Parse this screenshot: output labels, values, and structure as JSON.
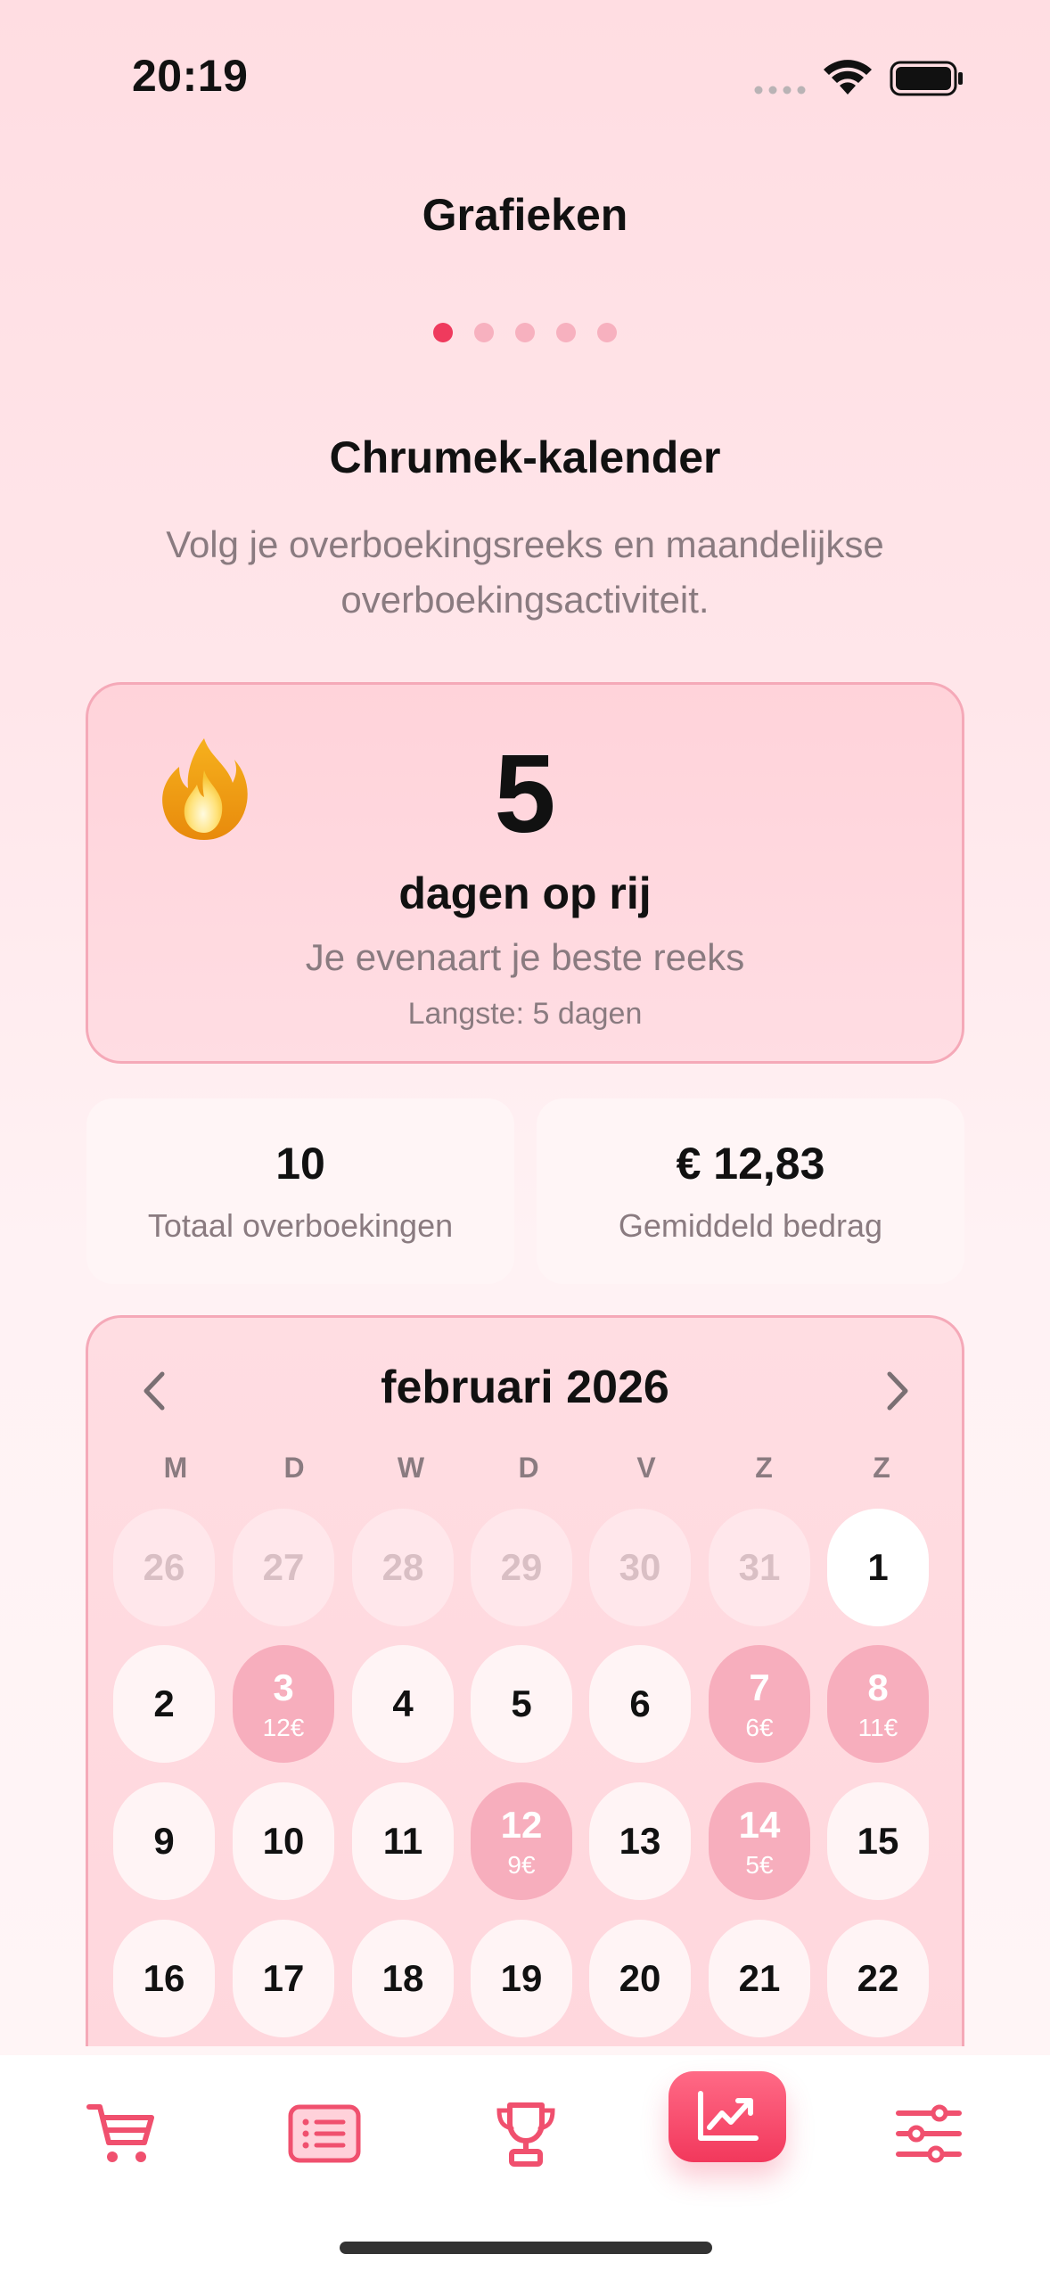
{
  "status_bar": {
    "time": "20:19"
  },
  "header": {
    "title": "Grafieken",
    "page_count": 5,
    "active_page": 1
  },
  "section": {
    "title": "Chrumek-kalender",
    "subtitle": "Volg je overboekingsreeks en maandelijkse overboekingsactiviteit."
  },
  "streak": {
    "icon": "flame-icon",
    "days": "5",
    "label": "dagen op rij",
    "message": "Je evenaart je beste reeks",
    "longest": "Langste: 5 dagen"
  },
  "stats": {
    "total_transfers_value": "10",
    "total_transfers_label": "Totaal overboekingen",
    "average_amount_value": "€ 12,83",
    "average_amount_label": "Gemiddeld bedrag"
  },
  "calendar": {
    "month": "februari 2026",
    "weekdays": [
      "M",
      "D",
      "W",
      "D",
      "V",
      "Z",
      "Z"
    ],
    "days": [
      {
        "num": "26",
        "muted": true
      },
      {
        "num": "27",
        "muted": true
      },
      {
        "num": "28",
        "muted": true
      },
      {
        "num": "29",
        "muted": true
      },
      {
        "num": "30",
        "muted": true
      },
      {
        "num": "31",
        "muted": true
      },
      {
        "num": "1",
        "today": true
      },
      {
        "num": "2"
      },
      {
        "num": "3",
        "amount": "12€"
      },
      {
        "num": "4"
      },
      {
        "num": "5"
      },
      {
        "num": "6"
      },
      {
        "num": "7",
        "amount": "6€"
      },
      {
        "num": "8",
        "amount": "11€"
      },
      {
        "num": "9"
      },
      {
        "num": "10"
      },
      {
        "num": "11"
      },
      {
        "num": "12",
        "amount": "9€"
      },
      {
        "num": "13"
      },
      {
        "num": "14",
        "amount": "5€"
      },
      {
        "num": "15"
      },
      {
        "num": "16"
      },
      {
        "num": "17"
      },
      {
        "num": "18"
      },
      {
        "num": "19"
      },
      {
        "num": "20"
      },
      {
        "num": "21"
      },
      {
        "num": "22"
      }
    ]
  },
  "tab_bar": {
    "tabs": [
      {
        "icon": "cart-icon"
      },
      {
        "icon": "list-icon"
      },
      {
        "icon": "trophy-icon"
      },
      {
        "icon": "chart-icon",
        "selected": true
      },
      {
        "icon": "sliders-icon"
      }
    ]
  },
  "colors": {
    "accent": "#ef3a5d",
    "accent_light": "#f7aebd",
    "muted_text": "#8a7b80"
  }
}
